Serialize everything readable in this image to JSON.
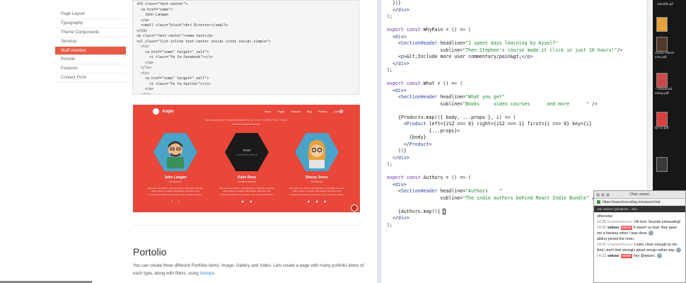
{
  "left_nav": {
    "items": [
      {
        "label": "Page Layout",
        "active": false
      },
      {
        "label": "Typography",
        "active": false
      },
      {
        "label": "Theme Components",
        "active": false
      },
      {
        "label": "Services",
        "active": false
      },
      {
        "label": "Staff member",
        "active": true
      },
      {
        "label": "Portolio",
        "active": false
      },
      {
        "label": "Features",
        "active": false
      },
      {
        "label": "Contact Form",
        "active": false
      }
    ]
  },
  "code_snippet": "<h3 class=\"text-center\">\n  <a href=\"some\">\n    John Langan\n  </a>\n  <small class=\"block\">Art Director</small>\n</h3>\n<p class=\"text-center\">some text</p>\n<ul class=\"list-inline text-center social-icons social-simple\">\n  <li>\n    <a href=\"some\" target=\"_self\">\n      <i class=\"fa fa-facebook\"></i>\n    </a>\n  </li>\n  <li>\n    <a href=\"some\" target=\"_self\">\n      <i class=\"fa fa-twitter\"></i>\n    </a>\n  </li>\n</ul>",
  "preview": {
    "logo": "Angle",
    "nav": [
      "Home",
      "Pages",
      "Features",
      "Blog",
      "Portfolio",
      "Contact"
    ],
    "subtitle": "AN AMAZING TEAM MEMBERS OF OUR CREATIVE TEAM",
    "members": [
      {
        "name": "John Langan",
        "role": "Art Director",
        "text": "Duis aute irure dolor in reprehenderit in voluptate velit esse cillum dolore eu fugiat nulla pariatur. Excepteur sint occaecat cupidatat non proident, sunt in culpa qui officia.",
        "icons": [
          "f",
          "t"
        ],
        "bg": "#4aa3c9"
      },
      {
        "name": "Katie Ross",
        "role": "Creative Director",
        "text": "Duis aute irure dolor in reprehenderit in voluptate velit esse cillum dolore eu fugiat nulla pariatur. Excepteur sint occaecat cupidatat non proident, sunt in culpa qui officia.",
        "icons": [
          "◉",
          "◉"
        ],
        "bg": "#1a1a1a"
      },
      {
        "name": "Stacey Jones",
        "role": "Art Director",
        "text": "Duis aute irure dolor in reprehenderit in voluptate velit esse cillum dolore eu fugiat nulla pariatur. Excepteur sint occaecat cupidatat non proident, sunt in culpa qui officia.",
        "icons": [
          "◉",
          "◉",
          "◉"
        ],
        "bg": "#4aa3c9"
      }
    ],
    "hover_text": "Smart",
    "hover_sub": "Lorem ipsum dolor sit"
  },
  "portolio": {
    "title": "Portolio",
    "text_before_link": "You can create three different Portfolio items. Image, Gallery and Video. Lets create a page with many portfolio items of each type, along with filters, using ",
    "link": "Isotope",
    "text_after_link": "."
  },
  "editor_lines": [
    "  })}",
    "  </div>",
    ");",
    "",
    "export const WhyPain = () => (",
    "  <div>",
    "    <SectionHeader headline=\"I spent days learning by myself\"",
    "                   subline=\"Then Stephen's course made it click in just 10 hours!\"/>",
    "    <p>&lt;Include more user commentary/pain&gt;</p>",
    "  </div>",
    ");",
    "",
    "export const What = () => (",
    "  <div>",
    "    <SectionHeader headline=\"What you get\"",
    "                   subline=\"Books     video courses      and more      \" />",
    "",
    "    {Products.map(({ body, ...props }, i) => (",
    "      <Product left={i%2 === 0} right={i%2 === 1} first={i === 0} key={i}",
    "               {...props}>",
    "        {body}",
    "      </Product>",
    "    ))}",
    "  </div>",
    ");",
    "",
    "export const Authors = () => (",
    "  <div>",
    "    <SectionHeader headline=\"Authors    \"",
    "                   subline=\"The indie authors behind React Indie Bundle\" />",
    "",
    "    {Authors.map(({ ",
    "  </div>",
    ");"
  ],
  "desktop_files": [
    {
      "label": "...handlin.gif"
    },
    {
      "label": ""
    },
    {
      "label": "urvive-Client-ices.pdf"
    },
    {
      "label": "- Advanced ening.pdf"
    },
    {
      "label": "ity-v1.pdf"
    },
    {
      "label": ""
    }
  ],
  "chat": {
    "title": "Chat: swizec",
    "url": "https://www.livecoding.tv/swizec/chat",
    "header": "Ask Swizec Questions · Join",
    "messages": [
      {
        "time": "",
        "user": "",
        "text": "otherwise",
        "badge": "",
        "avatar": false
      },
      {
        "time": "14:20",
        "user": "brianbarkhouse",
        "text": "Oh lord. Sounds exhausting!",
        "badge": "",
        "avatar": false
      },
      {
        "time": "14:20",
        "user": "swizec",
        "text": "It wasn't so bad, they gave me a banana when I was done",
        "badge": "owner",
        "avatar": true
      },
      {
        "time": "",
        "user": "",
        "text": "alekcy joined the room.",
        "badge": "",
        "avatar": false
      },
      {
        "time": "14:21",
        "user": "brianbarkhouse",
        "text": "Looks close enough to me. And I don't feel strongly about emojis either way",
        "badge": "",
        "avatar": true
      },
      {
        "time": "14:22",
        "user": "swizec",
        "text": "hey @swizec",
        "badge": "owner",
        "avatar": true
      }
    ]
  },
  "colors": {
    "accent": "#e8473a",
    "nav_active": "#e65a45",
    "link": "#3b8bd3"
  }
}
